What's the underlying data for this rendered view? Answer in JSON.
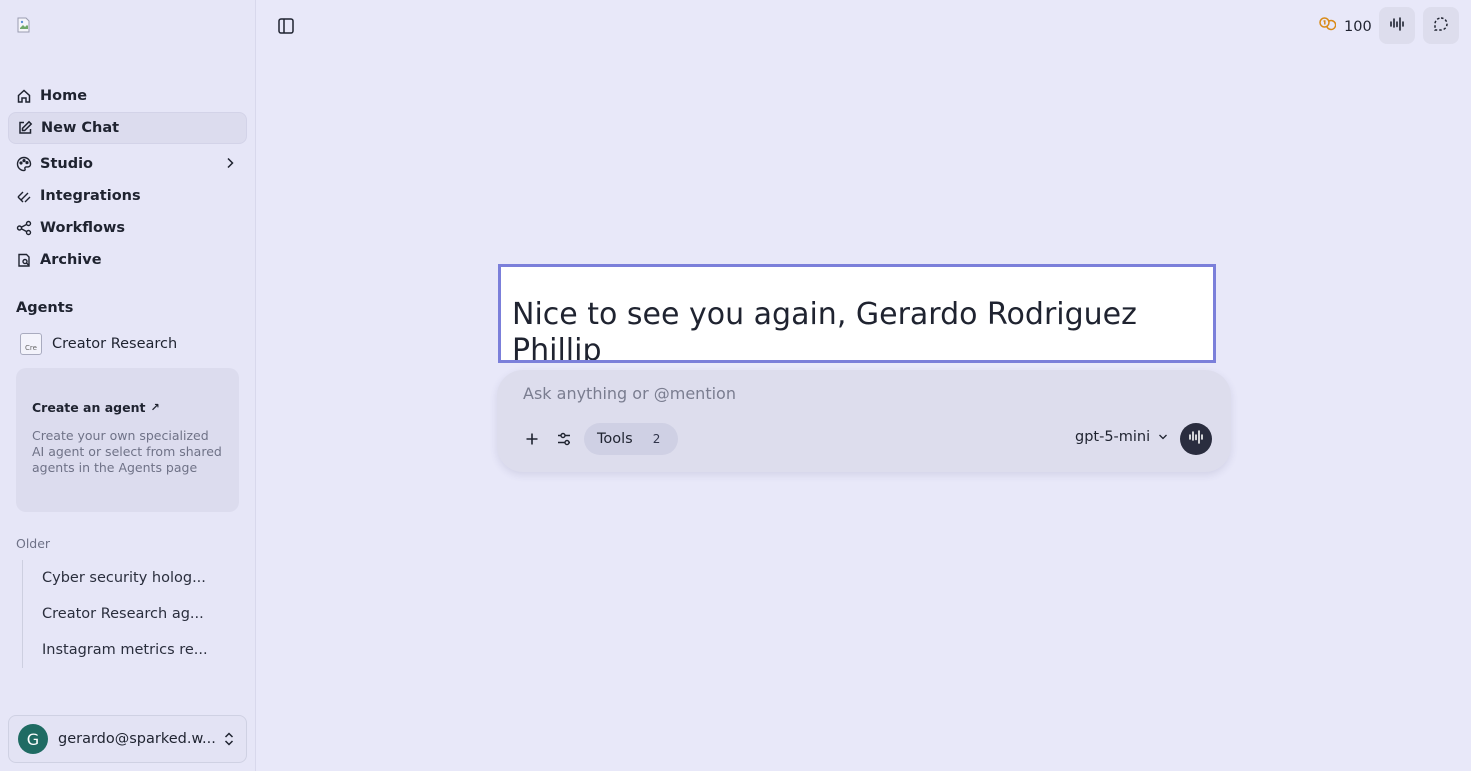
{
  "sidebar": {
    "logo_icon": "broken-image-icon",
    "nav": [
      {
        "label": "Home",
        "icon": "home-icon"
      },
      {
        "label": "New Chat",
        "icon": "edit-icon"
      },
      {
        "label": "Studio",
        "icon": "palette-icon"
      },
      {
        "label": "Integrations",
        "icon": "integrations-icon"
      },
      {
        "label": "Workflows",
        "icon": "workflow-icon"
      },
      {
        "label": "Archive",
        "icon": "archive-icon"
      }
    ],
    "agents_heading": "Agents",
    "agent": {
      "avatar_alt": "Cre",
      "label": "Creator Research"
    },
    "create_card": {
      "title": "Create an agent",
      "arrow": "↗",
      "description": "Create your own specialized AI agent or select from shared agents in the Agents page"
    },
    "older_heading": "Older",
    "history": [
      "Cyber security holog...",
      "Creator Research ag...",
      "Instagram metrics re..."
    ],
    "user": {
      "initial": "G",
      "email": "gerardo@sparked.w..."
    }
  },
  "topbar": {
    "credits": "100",
    "credits_icon": "coins-icon",
    "accent": "#d98a17"
  },
  "main": {
    "greeting": "Nice to see you again, Gerardo Rodriguez Phillip",
    "composer": {
      "placeholder": "Ask anything or @mention",
      "tools_label": "Tools",
      "tools_count": "2",
      "model": "gpt-5-mini"
    }
  }
}
